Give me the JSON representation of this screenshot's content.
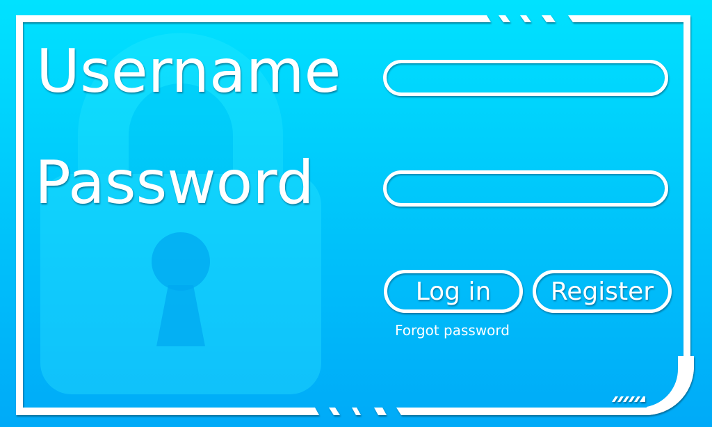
{
  "form": {
    "username_label": "Username",
    "username_value": "",
    "password_label": "Password",
    "password_value": "",
    "login_label": "Log in",
    "register_label": "Register",
    "forgot_label": "Forgot password"
  },
  "icons": {
    "background": "padlock-icon"
  },
  "colors": {
    "background_top": "#00e2ff",
    "background_bottom": "#00aaf8",
    "frame": "#ffffff",
    "text": "#ffffff"
  }
}
